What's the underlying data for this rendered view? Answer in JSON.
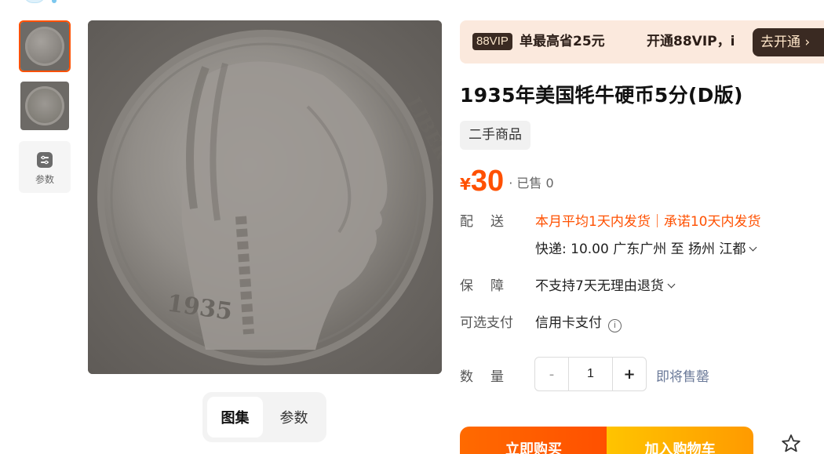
{
  "gallery": {
    "thumbnails": [
      "coin-front",
      "coin-back"
    ],
    "params_label": "参数",
    "tabs": [
      "图集",
      "参数"
    ],
    "active_tab": "图集",
    "main_image": {
      "coin_year": "1935",
      "coin_legend": "LIBERTY"
    }
  },
  "vip": {
    "badge": "88VIP",
    "save_text": "单最高省25元",
    "open_text": "开通88VIP，i",
    "button": "去开通 ›"
  },
  "product": {
    "title": "1935年美国牦牛硬币5分(D版)",
    "tag": "二手商品",
    "currency": "¥",
    "price": "30",
    "sold": "· 已售 0"
  },
  "shipping": {
    "label": "配送",
    "promise": "本月平均1天内发货｜承诺10天内发货",
    "detail": "快递: 10.00  广东广州  至  扬州 江都"
  },
  "guarantee": {
    "label": "保障",
    "value": "不支持7天无理由退货"
  },
  "payment": {
    "label": "可选支付",
    "value": "信用卡支付",
    "info_icon": "info-circle-icon"
  },
  "quantity": {
    "label": "数量",
    "minus": "-",
    "value": "1",
    "plus": "+",
    "status": "即将售罄"
  },
  "actions": {
    "buy": "立即购买",
    "cart": "加入购物车",
    "favorite_icon": "star-outline-icon"
  },
  "colors": {
    "accent": "#ff5000",
    "vip_bg": "#fbe9dd",
    "vip_dark": "#3a2a22",
    "cart_yellow": "#ffb300"
  }
}
